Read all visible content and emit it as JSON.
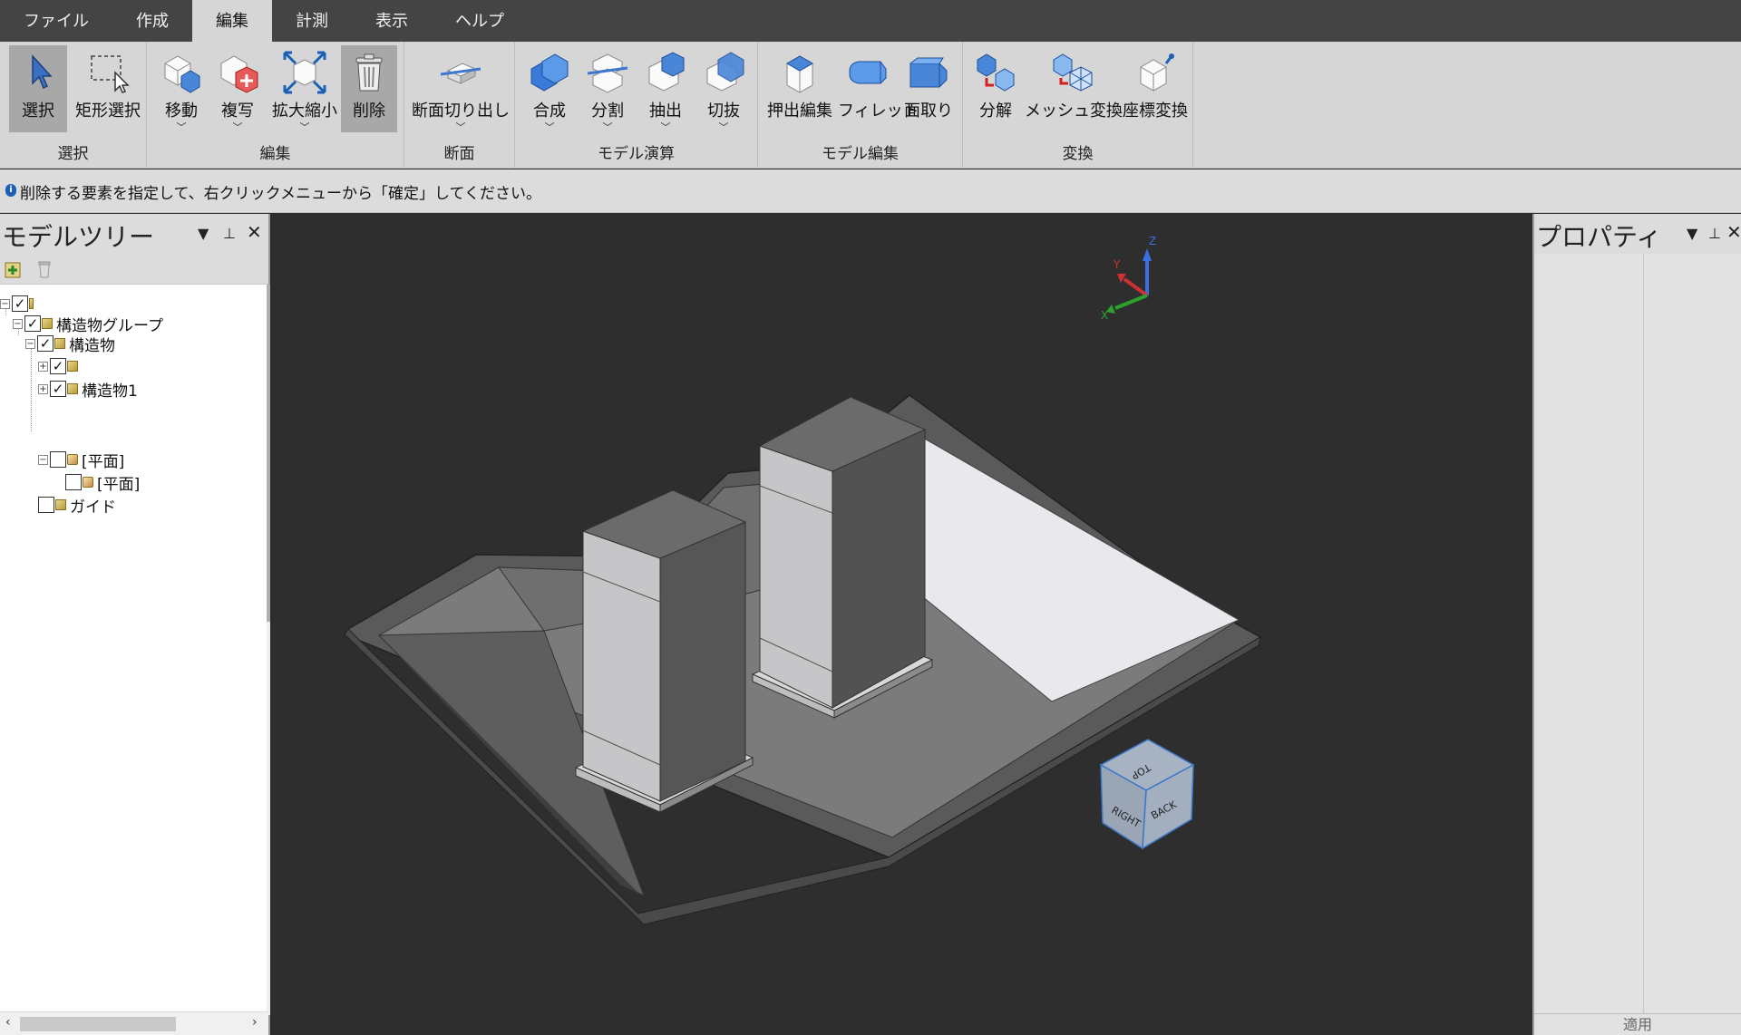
{
  "menubar": {
    "tabs": [
      "ファイル",
      "作成",
      "編集",
      "計測",
      "表示",
      "ヘルプ"
    ],
    "active_index": 2
  },
  "ribbon": {
    "groups": {
      "select": "選択",
      "edit": "編集",
      "section": "断面",
      "model_ops": "モデル演算",
      "model_edit": "モデル編集",
      "convert": "変換"
    },
    "buttons": {
      "select": "選択",
      "rect_select": "矩形選択",
      "move": "移動",
      "copy": "複写",
      "scale": "拡大縮小",
      "delete": "削除",
      "section_cut": "断面切り出し",
      "combine": "合成",
      "split": "分割",
      "extract": "抽出",
      "cut": "切抜",
      "extrude_edit": "押出編集",
      "fillet": "フィレット",
      "chamfer": "面取り",
      "decompose": "分解",
      "mesh_convert": "メッシュ変換",
      "coord_convert": "座標変換"
    }
  },
  "status": {
    "message": "削除する要素を指定して、右クリックメニューから「確定」してください。"
  },
  "left_panel": {
    "title": "モデルツリー",
    "tree": [
      {
        "label": "",
        "checked": true,
        "level": 0
      },
      {
        "label": "構造物グループ",
        "checked": true,
        "level": 1
      },
      {
        "label": "構造物",
        "checked": true,
        "level": 2
      },
      {
        "label": "",
        "checked": true,
        "level": 3
      },
      {
        "label": "構造物1",
        "checked": true,
        "level": 3
      },
      {
        "label": "[平面]",
        "checked": false,
        "level": 3
      },
      {
        "label": "[平面]",
        "checked": false,
        "level": 4
      },
      {
        "label": "ガイド",
        "checked": false,
        "level": 2
      }
    ]
  },
  "right_panel": {
    "title": "プロパティ",
    "apply_label": "適用"
  },
  "viewport": {
    "axis_labels": {
      "x": "X",
      "y": "Y",
      "z": "Z"
    },
    "view_cube": {
      "top": "TOP",
      "right": "RIGHT",
      "back": "BACK"
    }
  }
}
